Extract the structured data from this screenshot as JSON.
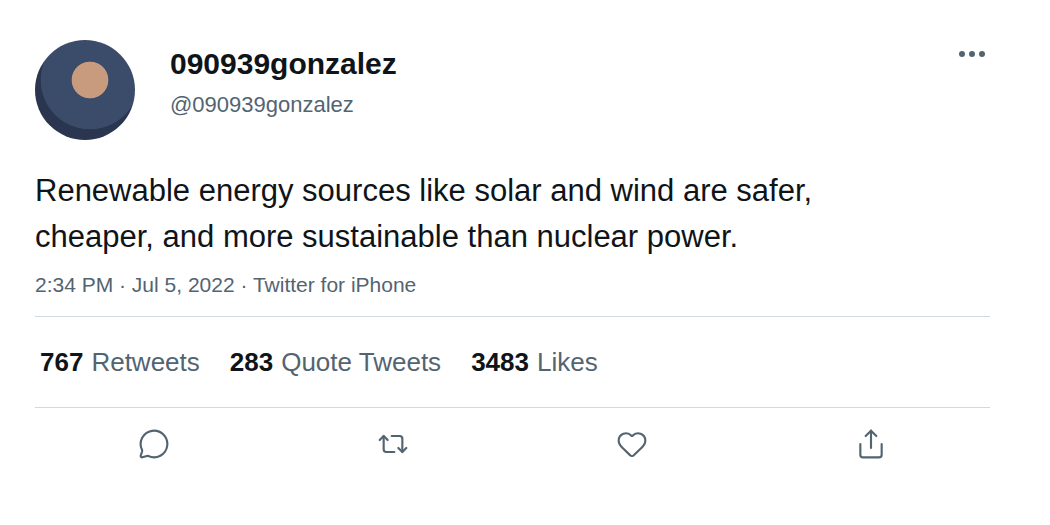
{
  "tweet": {
    "author": {
      "name": "090939gonzalez",
      "handle": "@090939gonzalez"
    },
    "text": "Renewable energy sources like solar and wind are safer, cheaper, and more sustainable than nuclear power.",
    "meta": "2:34 PM · Jul 5, 2022 · Twitter for iPhone"
  },
  "stats": [
    {
      "count": "767",
      "label": "Retweets"
    },
    {
      "count": "283",
      "label": "Quote Tweets"
    },
    {
      "count": "3483",
      "label": "Likes"
    }
  ],
  "actions": [
    {
      "kind": "reply"
    },
    {
      "kind": "retweet"
    },
    {
      "kind": "like"
    },
    {
      "kind": "share"
    }
  ]
}
